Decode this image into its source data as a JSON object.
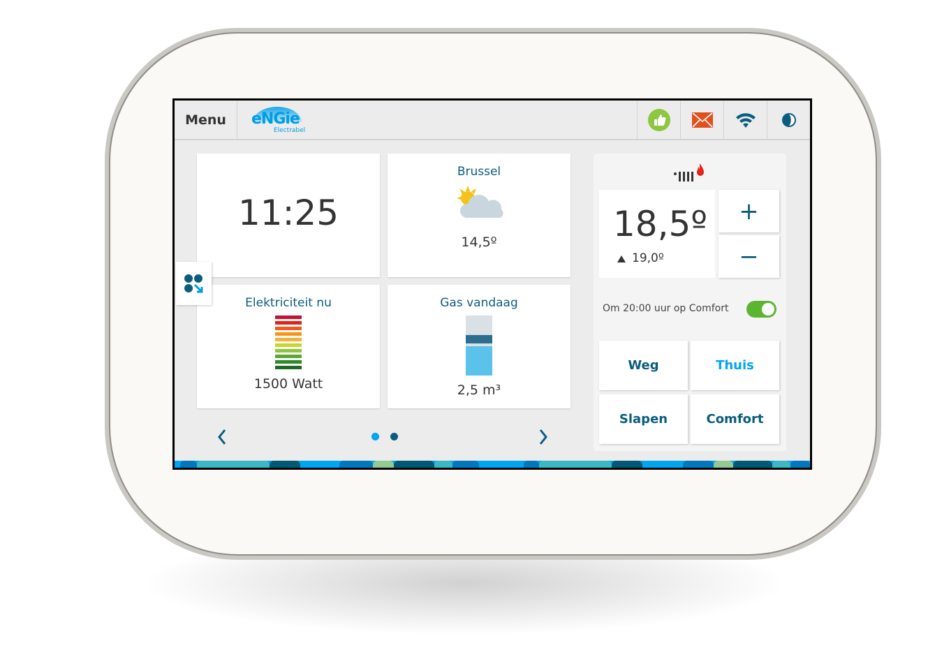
{
  "header": {
    "menu_label": "Menu",
    "logo": "ENGIE",
    "logo_sub": "Electrabel",
    "icons": [
      "thumbs-up-icon",
      "mail-icon",
      "wifi-icon",
      "moon-icon"
    ]
  },
  "tiles": {
    "clock": {
      "time": "11:25"
    },
    "weather": {
      "city": "Brussel",
      "icon": "partly-cloudy-icon",
      "temperature": "14,5º"
    },
    "electricity": {
      "title": "Elektriciteit nu",
      "value": "1500 Watt"
    },
    "gas": {
      "title": "Gas vandaag",
      "value": "2,5 m³"
    }
  },
  "thermostat": {
    "icon": "radiator-flame-icon",
    "current": "18,5º",
    "target": "19,0º",
    "plus": "+",
    "minus": "−",
    "schedule_text": "Om 20:00 uur op Comfort",
    "schedule_enabled": true,
    "modes": [
      {
        "label": "Weg",
        "active": false
      },
      {
        "label": "Thuis",
        "active": true
      },
      {
        "label": "Slapen",
        "active": false
      },
      {
        "label": "Comfort",
        "active": false
      }
    ]
  },
  "pagination": {
    "current": 1,
    "total": 2
  },
  "colors": {
    "accent": "#009de0",
    "dark": "#0b5d7e",
    "toggle": "#5cb531",
    "thumb": "#8dc63f",
    "mail": "#e0511f"
  }
}
